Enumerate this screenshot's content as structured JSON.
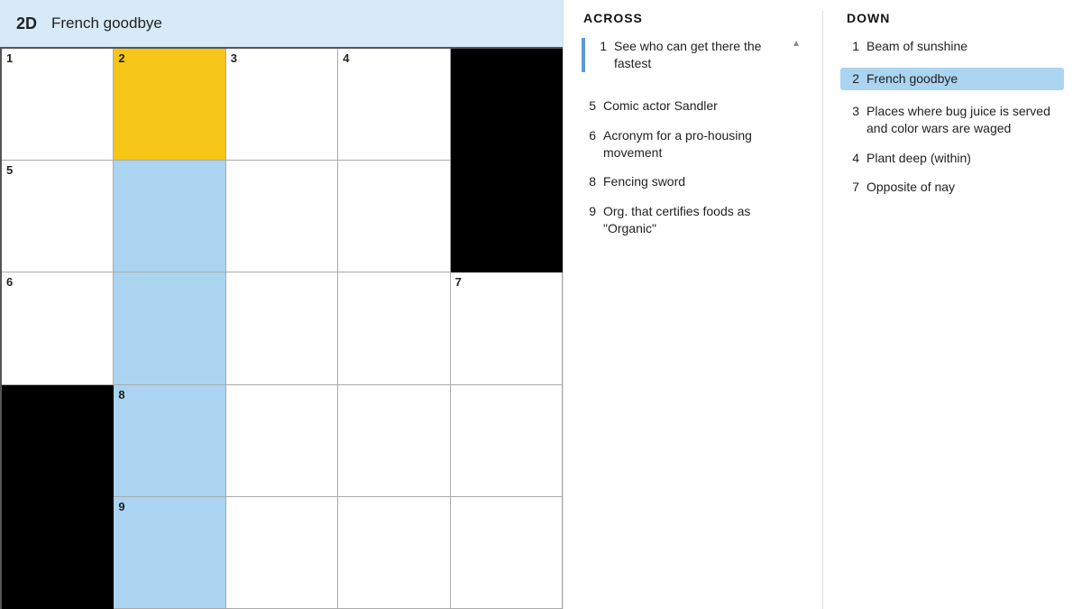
{
  "header": {
    "clue_number": "2D",
    "clue_text": "French goodbye"
  },
  "grid": {
    "cells": [
      {
        "row": 0,
        "col": 0,
        "type": "white",
        "number": "1"
      },
      {
        "row": 0,
        "col": 1,
        "type": "yellow",
        "number": "2"
      },
      {
        "row": 0,
        "col": 2,
        "type": "white",
        "number": "3"
      },
      {
        "row": 0,
        "col": 3,
        "type": "white",
        "number": "4"
      },
      {
        "row": 0,
        "col": 4,
        "type": "black",
        "number": ""
      },
      {
        "row": 1,
        "col": 0,
        "type": "white",
        "number": "5"
      },
      {
        "row": 1,
        "col": 1,
        "type": "blue",
        "number": ""
      },
      {
        "row": 1,
        "col": 2,
        "type": "white",
        "number": ""
      },
      {
        "row": 1,
        "col": 3,
        "type": "white",
        "number": ""
      },
      {
        "row": 1,
        "col": 4,
        "type": "black",
        "number": ""
      },
      {
        "row": 2,
        "col": 0,
        "type": "white",
        "number": "6"
      },
      {
        "row": 2,
        "col": 1,
        "type": "blue",
        "number": ""
      },
      {
        "row": 2,
        "col": 2,
        "type": "white",
        "number": ""
      },
      {
        "row": 2,
        "col": 3,
        "type": "white",
        "number": ""
      },
      {
        "row": 2,
        "col": 4,
        "type": "white",
        "number": "7"
      },
      {
        "row": 3,
        "col": 0,
        "type": "black",
        "number": ""
      },
      {
        "row": 3,
        "col": 1,
        "type": "blue",
        "number": "8"
      },
      {
        "row": 3,
        "col": 2,
        "type": "white",
        "number": ""
      },
      {
        "row": 3,
        "col": 3,
        "type": "white",
        "number": ""
      },
      {
        "row": 3,
        "col": 4,
        "type": "white",
        "number": ""
      },
      {
        "row": 4,
        "col": 0,
        "type": "black",
        "number": ""
      },
      {
        "row": 4,
        "col": 1,
        "type": "blue",
        "number": "9"
      },
      {
        "row": 4,
        "col": 2,
        "type": "white",
        "number": ""
      },
      {
        "row": 4,
        "col": 3,
        "type": "white",
        "number": ""
      },
      {
        "row": 4,
        "col": 4,
        "type": "white",
        "number": ""
      }
    ]
  },
  "across": {
    "title": "ACROSS",
    "clues": [
      {
        "number": "1",
        "text": "See who can get there the fastest",
        "active": false,
        "has_progress": true
      },
      {
        "number": "5",
        "text": "Comic actor Sandler",
        "active": false,
        "has_progress": false
      },
      {
        "number": "6",
        "text": "Acronym for a pro-housing movement",
        "active": false,
        "has_progress": false
      },
      {
        "number": "8",
        "text": "Fencing sword",
        "active": false,
        "has_progress": false
      },
      {
        "number": "9",
        "text": "Org. that certifies foods as \"Organic\"",
        "active": false,
        "has_progress": false
      }
    ]
  },
  "down": {
    "title": "DOWN",
    "clues": [
      {
        "number": "1",
        "text": "Beam of sunshine",
        "active": false,
        "has_progress": false
      },
      {
        "number": "2",
        "text": "French goodbye",
        "active": true,
        "has_progress": false
      },
      {
        "number": "3",
        "text": "Places where bug juice is served and color wars are waged",
        "active": false,
        "has_progress": false
      },
      {
        "number": "4",
        "text": "Plant deep (within)",
        "active": false,
        "has_progress": false
      },
      {
        "number": "7",
        "text": "Opposite of nay",
        "active": false,
        "has_progress": false
      }
    ]
  }
}
